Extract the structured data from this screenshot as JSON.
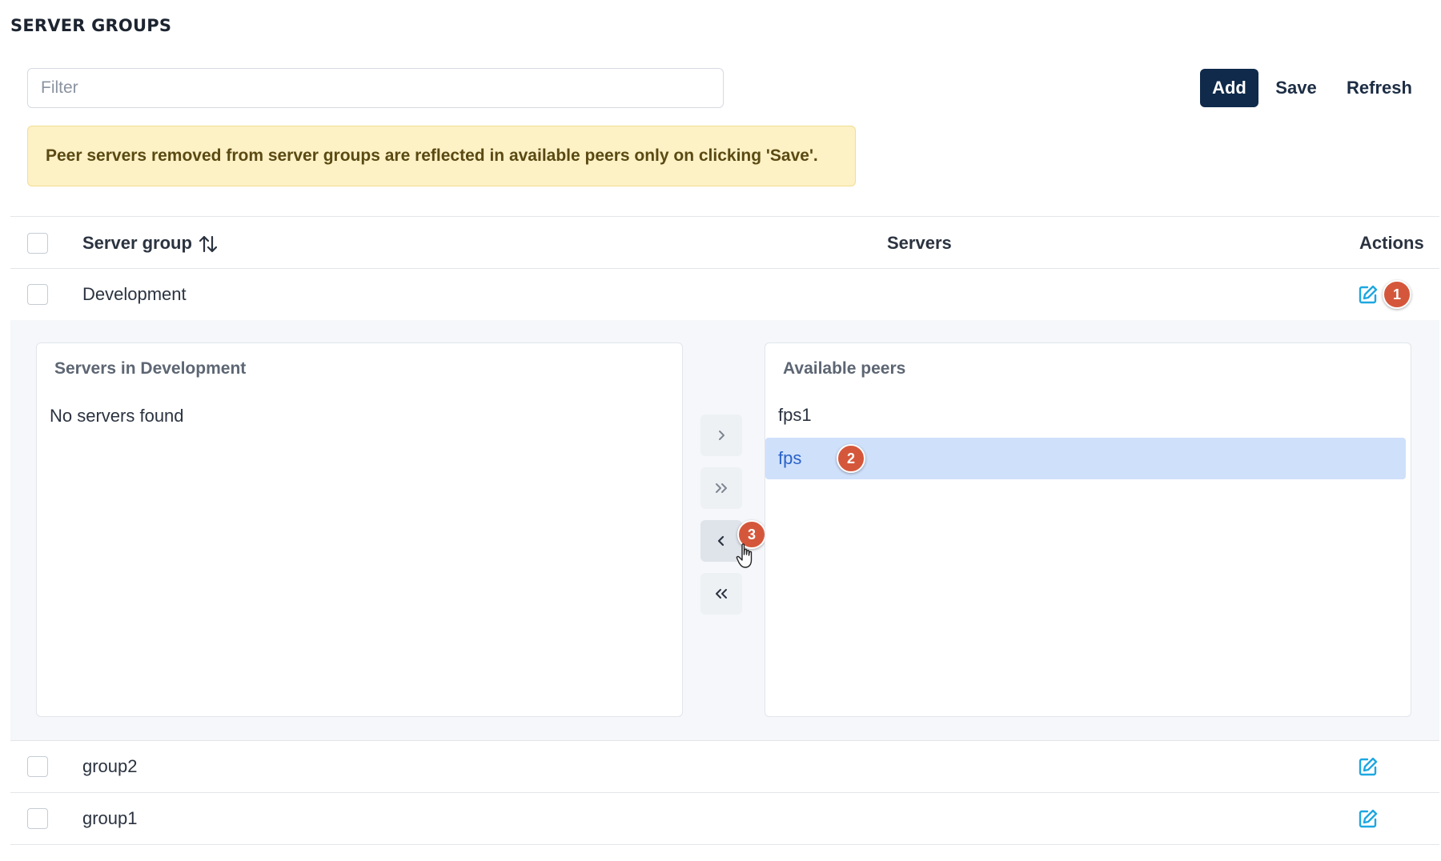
{
  "page": {
    "title": "SERVER GROUPS"
  },
  "toolbar": {
    "filter_placeholder": "Filter",
    "add_label": "Add",
    "save_label": "Save",
    "refresh_label": "Refresh"
  },
  "alert": {
    "message": "Peer servers removed from server groups are reflected in available peers only on clicking 'Save'."
  },
  "table": {
    "columns": {
      "server_group": "Server group",
      "servers": "Servers",
      "actions": "Actions"
    },
    "rows": [
      {
        "name": "Development"
      },
      {
        "name": "group2"
      },
      {
        "name": "group1"
      }
    ]
  },
  "expanded": {
    "left_title": "Servers in Development",
    "left_empty": "No servers found",
    "right_title": "Available peers",
    "peers": [
      {
        "name": "fps1",
        "selected": false
      },
      {
        "name": "fps",
        "selected": true
      }
    ],
    "move_buttons": [
      {
        "icon": "chevron-right-icon",
        "glyph": "›"
      },
      {
        "icon": "double-chevron-right-icon",
        "glyph": "»"
      },
      {
        "icon": "chevron-left-icon",
        "glyph": "‹"
      },
      {
        "icon": "double-chevron-left-icon",
        "glyph": "«"
      }
    ]
  },
  "badges": {
    "one": "1",
    "two": "2",
    "three": "3"
  },
  "colors": {
    "primary": "#0f2a4a",
    "accent_edit": "#1ea7e1",
    "alert_bg": "#fdf1c6",
    "selected_bg": "#cfe0fb",
    "badge": "#d5573b"
  }
}
